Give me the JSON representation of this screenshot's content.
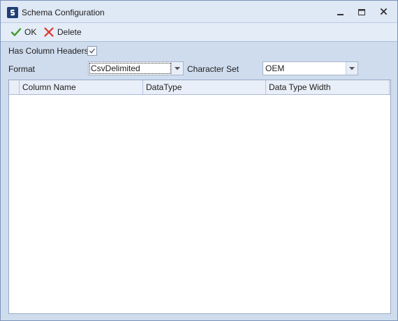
{
  "window": {
    "title": "Schema Configuration"
  },
  "toolbar": {
    "ok_label": "OK",
    "delete_label": "Delete"
  },
  "form": {
    "has_column_headers_label": "Has Column Headers",
    "has_column_headers_checked": true,
    "format_label": "Format",
    "format_value": "CsvDelimited",
    "charset_label": "Character Set",
    "charset_value": "OEM"
  },
  "grid": {
    "columns": [
      "Column Name",
      "DataType",
      "Data Type Width"
    ],
    "rows": []
  },
  "colors": {
    "window_bg": "#cfdcee",
    "titlebar_bg": "#dfe8f5",
    "ok_icon": "#3e9a2c",
    "delete_icon": "#d9362b"
  },
  "icons": {
    "app": "app-logo-icon",
    "ok": "check-icon",
    "delete": "x-icon",
    "minimize": "minimize-icon",
    "maximize": "maximize-icon",
    "close": "close-icon",
    "dropdown": "chevron-down-icon"
  }
}
